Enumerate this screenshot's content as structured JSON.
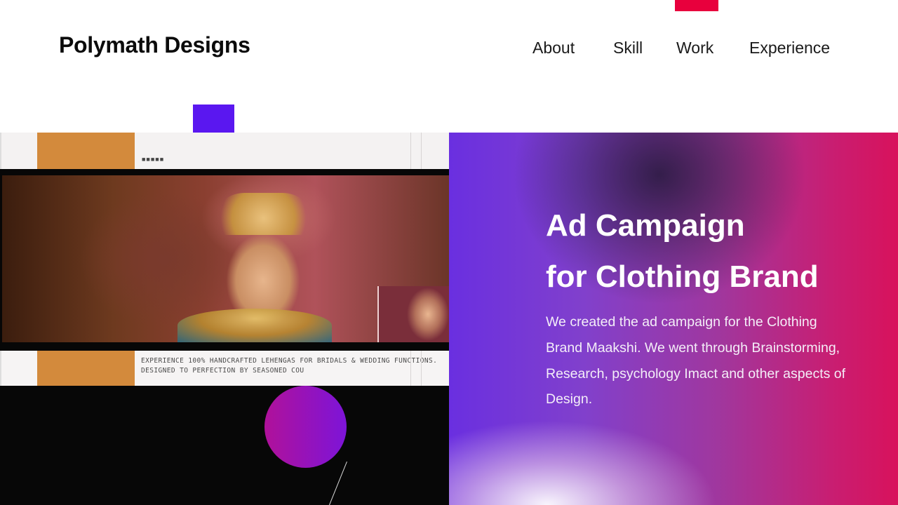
{
  "header": {
    "logo": "Polymath Designs",
    "nav": [
      "About",
      "Skill",
      "Work",
      "Experience"
    ]
  },
  "showcase": {
    "dots": "■■■■■",
    "caption_line1": "EXPERIENCE 100% HANDCRAFTED LEHENGAS FOR BRIDALS & WEDDING FUNCTIONS.",
    "caption_line2": "DESIGNED TO PERFECTION BY SEASONED COU"
  },
  "project": {
    "title_line1": "Ad Campaign",
    "title_line2": "for Clothing Brand",
    "description": "We created the ad campaign for the Clothing Brand Maakshi. We went through Brainstorming, Research, psychology Imact and other aspects of Design."
  },
  "colors": {
    "accent_red": "#e8003d",
    "accent_violet": "#5a17f0",
    "mock_orange": "#d38a3c",
    "panel_start": "#6a2fe0",
    "panel_end": "#d8125c"
  }
}
